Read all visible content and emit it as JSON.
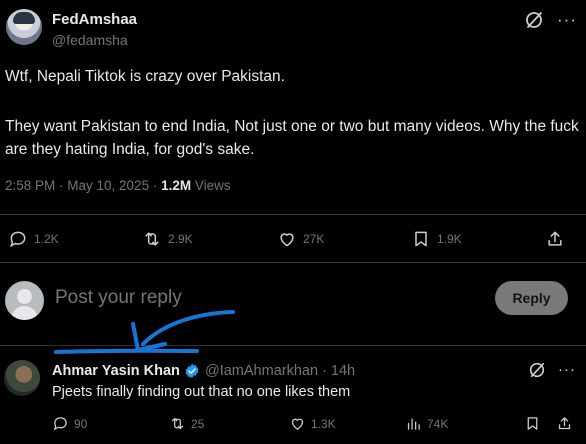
{
  "tweet": {
    "author_name": "FedAmshaa",
    "author_handle": "@fedamsha",
    "line1": "Wtf, Nepali Tiktok is crazy over Pakistan.",
    "line2": "They want Pakistan to end India, Not just one or two but many videos. Why the fuck are they hating India, for god's sake.",
    "time": "2:58 PM · May 10, 2025 · ",
    "views_count": "1.2M",
    "views_label": " Views",
    "stats": {
      "replies": "1.2K",
      "reposts": "2.9K",
      "likes": "27K",
      "bookmarks": "1.9K"
    }
  },
  "composer": {
    "placeholder": "Post your reply",
    "button_label": "Reply"
  },
  "reply": {
    "author_name": "Ahmar Yasin Khan",
    "author_handle": "@IamAhmarkhan · 14h",
    "text": "Pjeets finally finding out that no one likes them",
    "stats": {
      "replies": "90",
      "reposts": "25",
      "likes": "1.3K",
      "views": "74K"
    }
  },
  "colors": {
    "background": "#000000",
    "text_primary": "#e7e9ea",
    "text_muted": "#71767b",
    "divider": "#2f3336",
    "reply_button": "#787a7a",
    "verified_badge": "#1d9bf0",
    "annotation_arrow": "#1576d6"
  },
  "icons": [
    "grok-icon",
    "more-icon",
    "reply-icon",
    "repost-icon",
    "like-icon",
    "bookmark-icon",
    "share-icon",
    "views-icon",
    "verified-badge-icon",
    "avatar-placeholder-icon"
  ]
}
